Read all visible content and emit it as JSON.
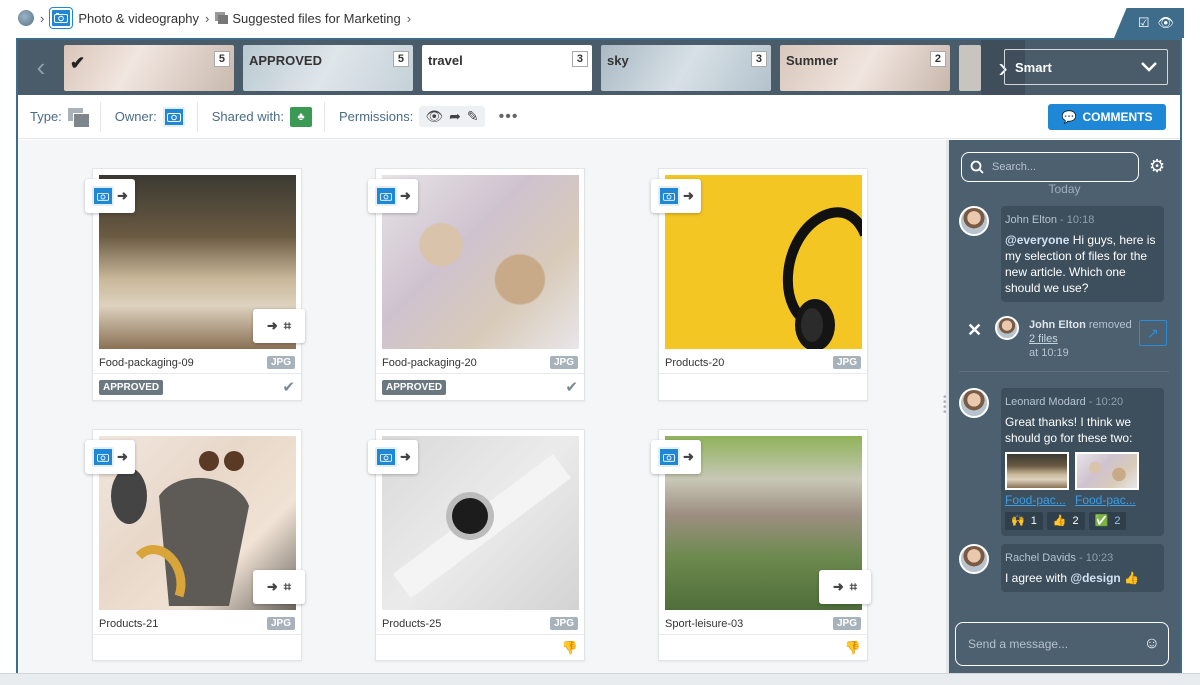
{
  "breadcrumb": {
    "items": [
      "Photo & videography",
      "Suggested files for Marketing"
    ]
  },
  "filters": {
    "chips": [
      {
        "label": "",
        "count": "5",
        "checked": true
      },
      {
        "label": "APPROVED",
        "count": "5"
      },
      {
        "label": "travel",
        "count": "3"
      },
      {
        "label": "sky",
        "count": "3"
      },
      {
        "label": "Summer",
        "count": "2"
      }
    ],
    "sort": "Smart"
  },
  "toolbar": {
    "type_label": "Type:",
    "owner_label": "Owner:",
    "shared_label": "Shared with:",
    "permissions_label": "Permissions:",
    "comments_label": "COMMENTS"
  },
  "files": [
    {
      "name": "Food-packaging-09",
      "ext": "JPG",
      "status": "APPROVED"
    },
    {
      "name": "Food-packaging-20",
      "ext": "JPG",
      "status": "APPROVED"
    },
    {
      "name": "Products-20",
      "ext": "JPG",
      "status": ""
    },
    {
      "name": "Products-21",
      "ext": "JPG",
      "status": ""
    },
    {
      "name": "Products-25",
      "ext": "JPG",
      "status": ""
    },
    {
      "name": "Sport-leisure-03",
      "ext": "JPG",
      "status": ""
    }
  ],
  "chat": {
    "search_placeholder": "Search...",
    "today": "Today",
    "messages": [
      {
        "author": "John Elton",
        "time": "10:18",
        "mention": "@everyone",
        "text": " Hi guys, here is my selection of files for the new article. Which one should we use?"
      },
      {
        "author": "Leonard Modard",
        "time": "10:20",
        "text": "Great thanks! I think we should go for these two:",
        "attachments": [
          "Food-pac...",
          "Food-pac..."
        ],
        "reactions": [
          {
            "emoji": "🙌",
            "count": "1"
          },
          {
            "emoji": "👍",
            "count": "2"
          },
          {
            "emoji": "✅",
            "count": "2"
          }
        ]
      },
      {
        "author": "Rachel Davids",
        "time": "10:23",
        "text": "I agree with ",
        "mention": "@design",
        "emoji": "👍"
      }
    ],
    "event": {
      "author": "John Elton",
      "action": "removed",
      "link": "2 files",
      "time": "at 10:19"
    },
    "send_placeholder": "Send a message..."
  },
  "colors": {
    "accent": "#1e88d6",
    "strip": "#4a5c6a",
    "chat_bg": "#4d6070",
    "frame": "#3e6d8c"
  }
}
